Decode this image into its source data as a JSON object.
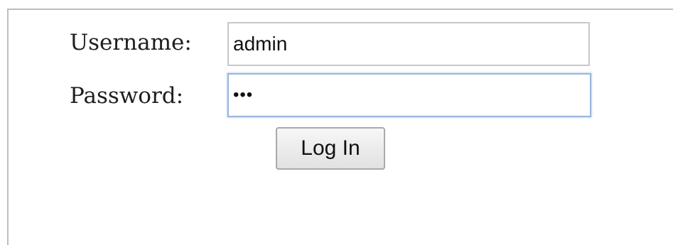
{
  "login_form": {
    "username_label": "Username:",
    "username_value": "admin",
    "password_label": "Password:",
    "password_masked": "•••",
    "login_button_label": "Log In"
  },
  "colors": {
    "focus_border": "#9ab6dc",
    "frame_border": "#bdbdbd"
  }
}
